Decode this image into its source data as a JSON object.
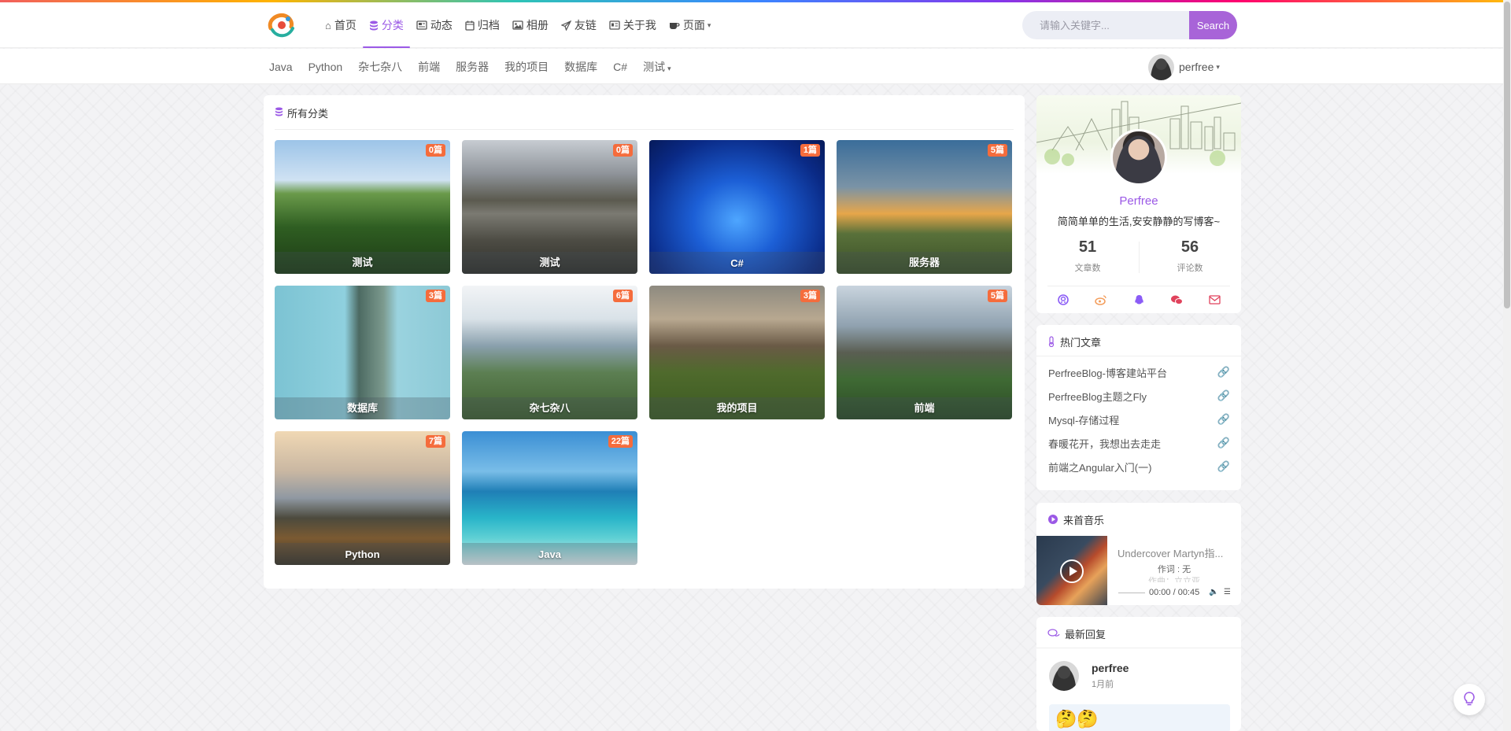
{
  "nav": {
    "items": [
      {
        "label": "首页",
        "icon": "home-icon"
      },
      {
        "label": "分类",
        "icon": "database-icon",
        "active": true
      },
      {
        "label": "动态",
        "icon": "newspaper-icon"
      },
      {
        "label": "归档",
        "icon": "calendar-icon"
      },
      {
        "label": "相册",
        "icon": "image-icon"
      },
      {
        "label": "友链",
        "icon": "paper-plane-icon"
      },
      {
        "label": "关于我",
        "icon": "id-card-icon"
      },
      {
        "label": "页面",
        "icon": "coffee-icon",
        "dropdown": true
      }
    ],
    "search_placeholder": "请输入关键字...",
    "search_button": "Search",
    "accent_color": "#9b59e6"
  },
  "subnav": {
    "items": [
      "Java",
      "Python",
      "杂七杂八",
      "前端",
      "服务器",
      "我的项目",
      "数据库",
      "C#",
      "测试"
    ],
    "user_name": "perfree"
  },
  "main": {
    "title": "所有分类",
    "categories": [
      {
        "name": "测试",
        "count": "0篇"
      },
      {
        "name": "测试",
        "count": "0篇"
      },
      {
        "name": "C#",
        "count": "1篇"
      },
      {
        "name": "服务器",
        "count": "5篇"
      },
      {
        "name": "数据库",
        "count": "3篇"
      },
      {
        "name": "杂七杂八",
        "count": "6篇"
      },
      {
        "name": "我的项目",
        "count": "3篇"
      },
      {
        "name": "前端",
        "count": "5篇"
      },
      {
        "name": "Python",
        "count": "7篇"
      },
      {
        "name": "Java",
        "count": "22篇"
      }
    ]
  },
  "profile": {
    "name": "Perfree",
    "motto": "简简单单的生活,安安静静的写博客~",
    "articles": "51",
    "articles_label": "文章数",
    "comments": "56",
    "comments_label": "评论数",
    "socials": [
      "github-icon",
      "weibo-icon",
      "qq-icon",
      "wechat-icon",
      "email-icon"
    ]
  },
  "hot": {
    "title": "热门文章",
    "items": [
      "PerfreeBlog-博客建站平台",
      "PerfreeBlog主题之Fly",
      "Mysql-存储过程",
      "春暖花开，我想出去走走",
      "前端之Angular入门(一)"
    ]
  },
  "music": {
    "title": "来首音乐",
    "song": "Undercover Martyn指...",
    "lyric": "作词 : 无",
    "lyric2": "作曲：立立亚",
    "time": "00:00 / 00:45"
  },
  "replies": {
    "title": "最新回复",
    "name": "perfree",
    "time": "1月前",
    "content": "🤔🤔"
  }
}
